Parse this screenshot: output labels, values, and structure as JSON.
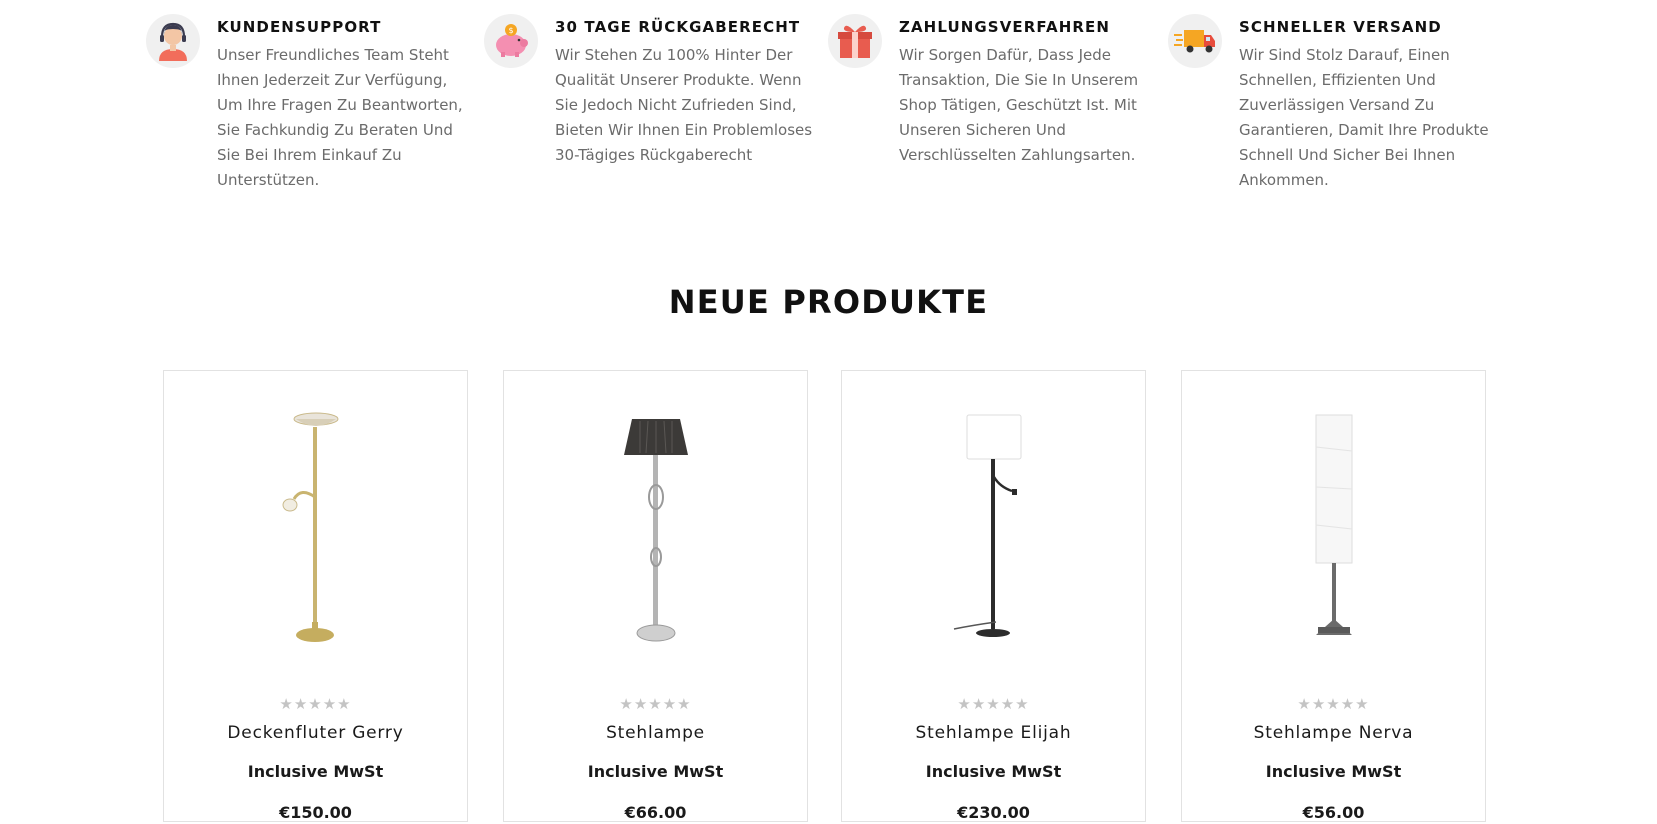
{
  "features": [
    {
      "icon": "support-agent-icon",
      "title": "KUNDENSUPPORT",
      "description": "Unser Freundliches Team Steht Ihnen Jederzeit Zur Verfügung, Um Ihre Fragen Zu Beantworten, Sie Fachkundig Zu Beraten Und Sie Bei Ihrem Einkauf Zu Unterstützen."
    },
    {
      "icon": "piggy-bank-icon",
      "title": "30 TAGE RÜCKGABERECHT",
      "description": "Wir Stehen Zu 100% Hinter Der Qualität Unserer Produkte. Wenn Sie Jedoch Nicht Zufrieden Sind, Bieten Wir Ihnen Ein Problemloses 30-Tägiges Rückgaberecht"
    },
    {
      "icon": "gift-icon",
      "title": "ZAHLUNGSVERFAHREN",
      "description": "Wir Sorgen Dafür, Dass Jede Transaktion, Die Sie In Unserem Shop Tätigen, Geschützt Ist. Mit Unseren Sicheren Und Verschlüsselten Zahlungsarten."
    },
    {
      "icon": "delivery-truck-icon",
      "title": "SCHNELLER VERSAND",
      "description": "Wir Sind Stolz Darauf, Einen Schnellen, Effizienten Und Zuverlässigen Versand Zu Garantieren, Damit Ihre Produkte Schnell Und Sicher Bei Ihnen Ankommen."
    }
  ],
  "section_title": "NEUE PRODUKTE",
  "products": [
    {
      "name": "Deckenfluter Gerry",
      "tax_label": "Inclusive MwSt",
      "price": "€150.00",
      "rating_stars": 0,
      "image_icon": "torchiere-floor-lamp-icon"
    },
    {
      "name": "Stehlampe",
      "tax_label": "Inclusive MwSt",
      "price": "€66.00",
      "rating_stars": 0,
      "image_icon": "shade-floor-lamp-icon"
    },
    {
      "name": "Stehlampe Elijah",
      "tax_label": "Inclusive MwSt",
      "price": "€230.00",
      "rating_stars": 0,
      "image_icon": "drum-shade-floor-lamp-icon"
    },
    {
      "name": "Stehlampe Nerva",
      "tax_label": "Inclusive MwSt",
      "price": "€56.00",
      "rating_stars": 0,
      "image_icon": "paper-column-floor-lamp-icon"
    }
  ],
  "star_glyphs": "★★★★★"
}
